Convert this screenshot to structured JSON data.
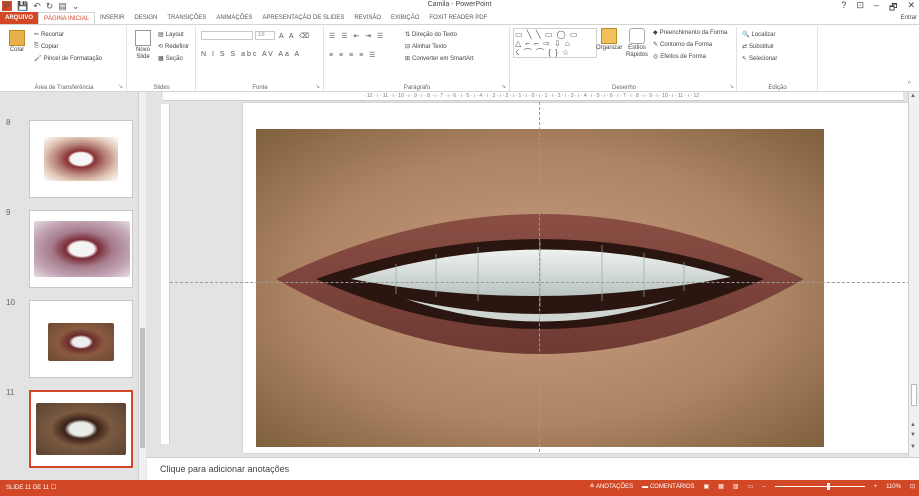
{
  "window": {
    "title": "Camila - PowerPoint",
    "help": "?",
    "ribbon_display": "⊡",
    "minimize": "–",
    "restore": "🗗",
    "close": "✕"
  },
  "tabs": [
    "ARQUIVO",
    "PÁGINA INICIAL",
    "INSERIR",
    "DESIGN",
    "TRANSIÇÕES",
    "ANIMAÇÕES",
    "APRESENTAÇÃO DE SLIDES",
    "REVISÃO",
    "EXIBIÇÃO",
    "FOXIT READER PDF"
  ],
  "signin": "Entrar",
  "ribbon": {
    "clipboard": {
      "paste": "Colar",
      "cut": "Recortar",
      "copy": "Copiar",
      "format_painter": "Pincel de Formatação",
      "label": "Área de Transferência"
    },
    "slides": {
      "new_slide": "Novo Slide",
      "layout": "Layout",
      "reset": "Redefinir",
      "section": "Seção",
      "label": "Slides"
    },
    "font": {
      "size": "18",
      "format_row": "N I S S abc AV Aa A",
      "label": "Fonte"
    },
    "paragraph": {
      "text_direction": "Direção do Texto",
      "align_text": "Alinhar Texto",
      "smartart": "Converter em SmartArt",
      "label": "Parágrafo"
    },
    "drawing": {
      "shapes_row1": "▭ ╲ ╲ ▭ ◯ ▭",
      "shapes_row2": "△ ⌐ ⌐ ⇨ ⇩ ⌂",
      "shapes_row3": "☇ ⌒ ⌒ { } ☆",
      "arrange": "Organizar",
      "quick_styles": "Estilos Rápidos",
      "shape_fill": "Preenchimento da Forma",
      "shape_outline": "Contorno da Forma",
      "shape_effects": "Efeitos de Forma",
      "label": "Desenho"
    },
    "editing": {
      "find": "Localizar",
      "replace": "Substituir",
      "select": "Selecionar",
      "label": "Edição"
    }
  },
  "thumbnails": [
    {
      "number": "8",
      "selected": false
    },
    {
      "number": "9",
      "selected": false
    },
    {
      "number": "10",
      "selected": false
    },
    {
      "number": "11",
      "selected": true
    }
  ],
  "ruler_text": "· 12 · ı · 11 · ı · 10 · ı · 9 · ı · 8 · ı · 7 · ı · 6 · ı · 5 · ı · 4 · ı · 3 · ı · 2 · ı · 1 · ı · 0 · ı · 1 · ı · 2 · ı · 3 · ı · 4 · ı · 5 · ı · 6 · ı · 7 · ı · 8 · ı · 9 · ı · 10 · ı · 11 · ı · 12 ·",
  "notes_placeholder": "Clique para adicionar anotações",
  "status": {
    "slide_info": "SLIDE 11 DE 11",
    "notes": "ANOTAÇÕES",
    "comments": "COMENTÁRIOS",
    "zoom": "110%"
  },
  "colors": {
    "accent": "#d24726"
  }
}
